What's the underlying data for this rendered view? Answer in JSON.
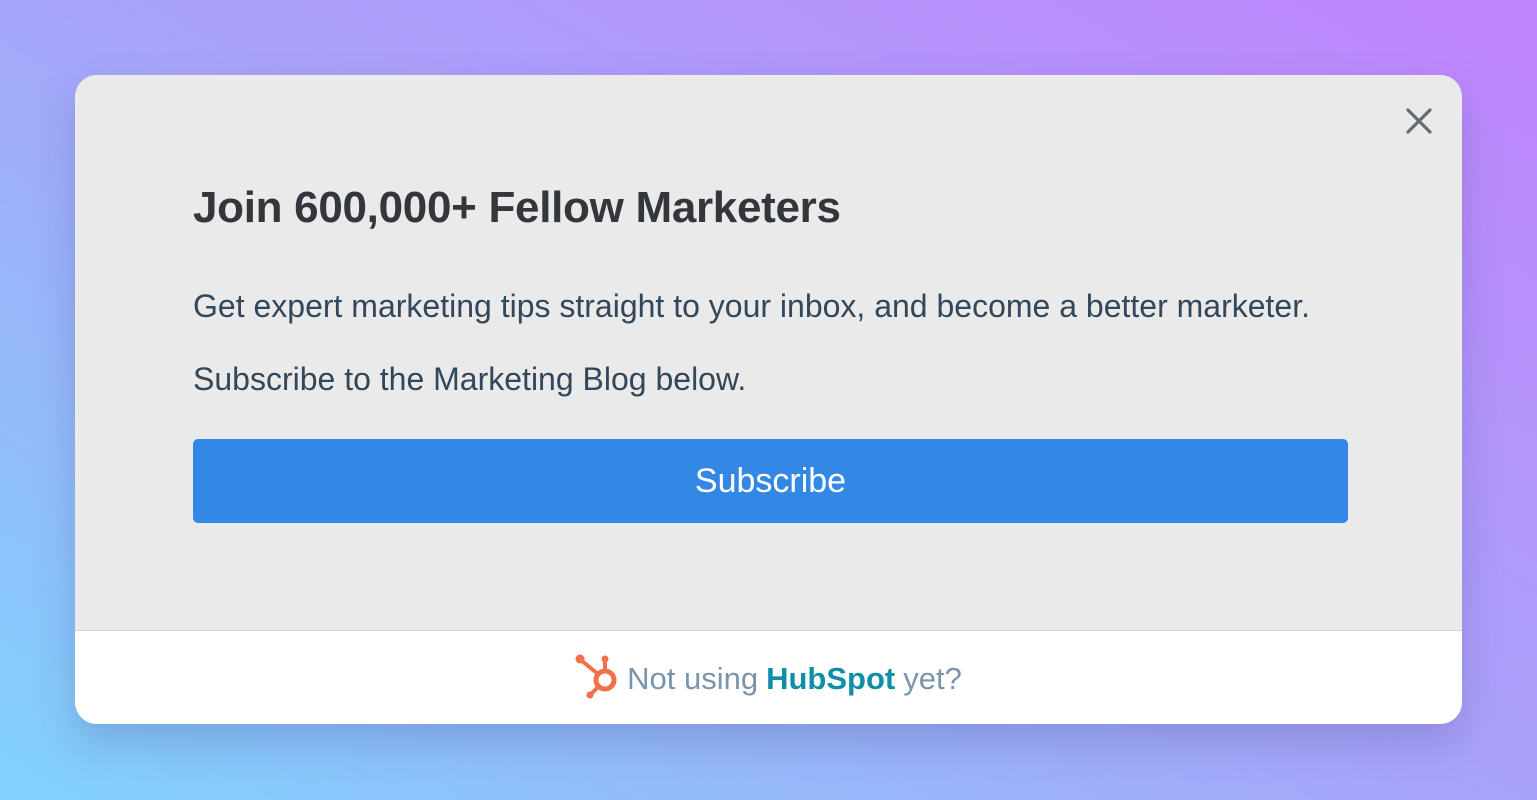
{
  "modal": {
    "title": "Join 600,000+ Fellow Marketers",
    "description": "Get expert marketing tips straight to your inbox, and become a better marketer. Subscribe to the Marketing Blog below.",
    "subscribe_label": "Subscribe",
    "close_icon": "close-icon"
  },
  "footer": {
    "logo_icon": "hubspot-sprocket-icon",
    "prefix": "Not using",
    "brand": "HubSpot",
    "suffix": "yet?"
  },
  "colors": {
    "button": "#3388e6",
    "brand": "#0f8fa6",
    "logo": "#f0704a",
    "title": "#33363b",
    "body_text": "#33475b"
  }
}
